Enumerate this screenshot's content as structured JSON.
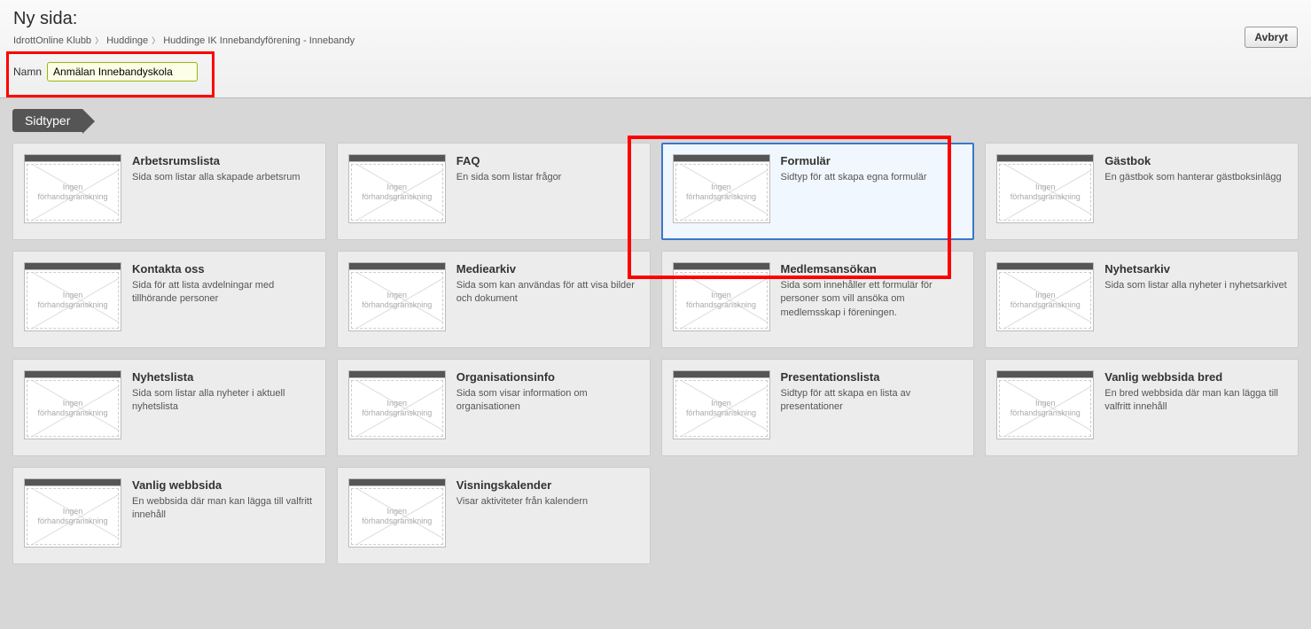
{
  "page_title": "Ny sida:",
  "breadcrumbs": [
    "IdrottOnline Klubb",
    "Huddinge",
    "Huddinge IK Innebandyförening - Innebandy"
  ],
  "name_label": "Namn",
  "name_value": "Anmälan Innebandyskola",
  "abort_label": "Avbryt",
  "section_label": "Sidtyper",
  "thumb_line1": "Ingen",
  "thumb_line2": "förhandsgranskning",
  "cards": [
    {
      "title": "Arbetsrumslista",
      "desc": "Sida som listar alla skapade arbetsrum",
      "selected": false
    },
    {
      "title": "FAQ",
      "desc": "En sida som listar frågor",
      "selected": false
    },
    {
      "title": "Formulär",
      "desc": "Sidtyp för att skapa egna formulär",
      "selected": true
    },
    {
      "title": "Gästbok",
      "desc": "En gästbok som hanterar gästboksinlägg",
      "selected": false
    },
    {
      "title": "Kontakta oss",
      "desc": "Sida för att lista avdelningar med tillhörande personer",
      "selected": false
    },
    {
      "title": "Mediearkiv",
      "desc": "Sida som kan användas för att visa bilder och dokument",
      "selected": false
    },
    {
      "title": "Medlemsansökan",
      "desc": "Sida som innehåller ett formulär för personer som vill ansöka om medlemsskap i föreningen.",
      "selected": false
    },
    {
      "title": "Nyhetsarkiv",
      "desc": "Sida som listar alla nyheter i nyhetsarkivet",
      "selected": false
    },
    {
      "title": "Nyhetslista",
      "desc": "Sida som listar alla nyheter i aktuell nyhetslista",
      "selected": false
    },
    {
      "title": "Organisationsinfo",
      "desc": "Sida som visar information om organisationen",
      "selected": false
    },
    {
      "title": "Presentationslista",
      "desc": "Sidtyp för att skapa en lista av presentationer",
      "selected": false
    },
    {
      "title": "Vanlig webbsida bred",
      "desc": "En bred webbsida där man kan lägga till valfritt innehåll",
      "selected": false
    },
    {
      "title": "Vanlig webbsida",
      "desc": "En webbsida där man kan lägga till valfritt innehåll",
      "selected": false
    },
    {
      "title": "Visningskalender",
      "desc": "Visar aktiviteter från kalendern",
      "selected": false
    }
  ]
}
